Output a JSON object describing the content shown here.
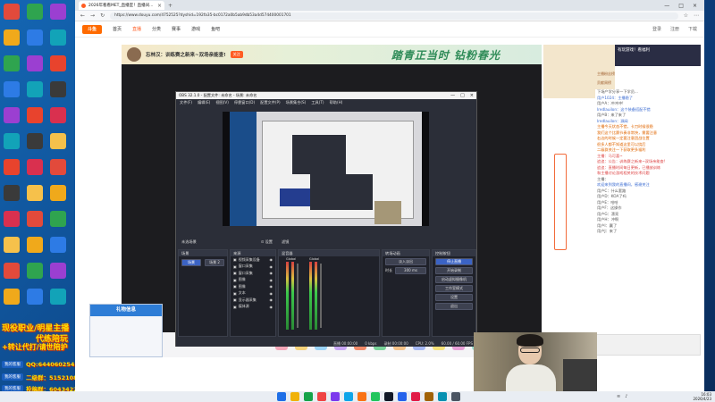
{
  "desktop": {
    "overlay": {
      "line1": "现役职业/明星主播",
      "line2": "代练陪玩",
      "line3": "+转让代打/请世陪护",
      "contacts": [
        {
          "badge": "我的客服",
          "qq": "QQ:644060254"
        },
        {
          "badge": "我的客服",
          "qq": "二级群：515210847"
        },
        {
          "badge": "我的客服",
          "qq": "投稿群：604342252"
        }
      ]
    }
  },
  "browser": {
    "tab_title": "2026年看看MET_直播室！直播间...",
    "url": "https://www.douyu.com/4752525?dyshid=192fa35-bc0172a0b5ab9db53a4d574400001701",
    "nav": {
      "logo": "斗鱼",
      "items": [
        "首页",
        "直播",
        "分类",
        "赛事",
        "游戏",
        "鱼吧"
      ],
      "active_index": 1,
      "right": [
        "登录",
        "注册",
        "下载"
      ]
    },
    "room": {
      "title": "忘林汉：训练赛之新来~双场亲能查!",
      "follow_label": "关注",
      "slogan": "踏青正当时 钻粉春光"
    },
    "ad_text": "有玩游戏！看福利",
    "rank_rows": [
      "主播粉丝榜",
      "贡献周榜",
      "贡献总榜",
      "粉丝团",
      "贵族"
    ],
    "chat_lines": [
      {
        "text": "下场产学分享一下学员...",
        "style": ""
      },
      {
        "text": "用户1024：主播稳了",
        "style": "blue"
      },
      {
        "text": "用户A：冲冲冲!",
        "style": ""
      },
      {
        "text": "Iredlauilon：这个装备搭配不错",
        "style": "blue"
      },
      {
        "text": "用户B：来了来了",
        "style": ""
      },
      {
        "text": "Iredlauilon：源阀",
        "style": "blue"
      },
      {
        "text": "主播今天状态不错，卡刀时候很稳",
        "style": "orange"
      },
      {
        "text": "我们这个比赛节奏非常快，需要注意",
        "style": "orange"
      },
      {
        "text": "右边的时候一定要注意团战位置",
        "style": "orange"
      },
      {
        "text": "很多人都不知道这里可以绕后",
        "style": "orange"
      },
      {
        "text": "二级群关注一下获取更多福利",
        "style": "orange"
      },
      {
        "text": "主播：马可喜~",
        "style": "red"
      },
      {
        "text": "追追：公告：训练赛之新来~双场亲能查!",
        "style": "red"
      },
      {
        "text": "追追：直播时间每日更新，已播放训练",
        "style": "red"
      },
      {
        "text": "和主播讨论游戏相关的技术问题",
        "style": "red"
      },
      {
        "text": "主播：",
        "style": ""
      },
      {
        "text": "欢迎来到我的直播间，感谢关注",
        "style": "blue"
      },
      {
        "text": "用户C：什么套路",
        "style": ""
      },
      {
        "text": "用户D：KOA了吗",
        "style": ""
      },
      {
        "text": "用户E：哈哈",
        "style": ""
      },
      {
        "text": "用户F：这操作",
        "style": ""
      },
      {
        "text": "用户G：漂亮",
        "style": ""
      },
      {
        "text": "用户H：冲啊",
        "style": ""
      },
      {
        "text": "用户I：赢了",
        "style": ""
      },
      {
        "text": "用户J：来了",
        "style": ""
      }
    ]
  },
  "obs": {
    "title": "OBS 32.1.0 - 配置文件: 未命名 - 场景: 未命名",
    "menu": [
      "文件(F)",
      "编辑(E)",
      "视图(V)",
      "停靠窗口(D)",
      "配置文件(P)",
      "场景集合(S)",
      "工具(T)",
      "帮助(H)"
    ],
    "scene_label": "未选场景",
    "scene_tabs": [
      "⊙ 设置",
      "滤镜"
    ],
    "docks": {
      "scenes": {
        "title": "场景",
        "items": [
          "场景",
          "场景 2"
        ]
      },
      "sources": {
        "title": "来源",
        "items": [
          "视频采集设备",
          "窗口采集",
          "窗口采集",
          "图像",
          "图像",
          "文本",
          "显示器采集",
          "媒体源"
        ]
      },
      "mixer": {
        "title": "混音器",
        "labels": [
          "Global",
          "Global"
        ],
        "channels": [
          "桌面音频",
          "麦克风/Aux"
        ],
        "db": [
          "0.0 dB",
          "0.0 dB"
        ]
      },
      "transitions": {
        "title": "转场动画",
        "selected": "淡入淡出",
        "duration_label": "时长",
        "duration": "300 ms"
      },
      "controls": {
        "title": "控制按钮",
        "buttons": [
          "停止直播",
          "开始录制",
          "启动虚拟摄像机",
          "工作室模式",
          "设置",
          "退出"
        ]
      }
    },
    "status": [
      "直播 00:00:00",
      "0 kbps",
      "录制 00:00:00",
      "CPU: 2.0%",
      "60.00 / 60.00 FPS"
    ],
    "options_label": "Options"
  },
  "gift_window": {
    "title": "礼物信息"
  },
  "taskbar": {
    "time": "16:03",
    "date": "2026/4/23",
    "icon_colors": [
      "#1f6fe6",
      "#f0b20a",
      "#16a34a",
      "#ef4444",
      "#7c3aed",
      "#0ea5e9",
      "#f97316",
      "#22c55e",
      "#111827",
      "#2563eb",
      "#e11d48",
      "#a16207",
      "#0891b2",
      "#4b5563"
    ]
  }
}
